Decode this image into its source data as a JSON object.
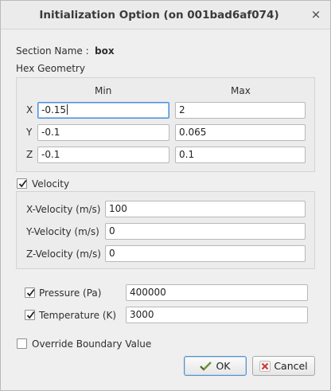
{
  "window": {
    "title": "Initialization Option (on 001bad6af074)",
    "close_glyph": "×"
  },
  "section": {
    "label": "Section Name :",
    "value": "box"
  },
  "hex": {
    "title": "Hex Geometry",
    "min_header": "Min",
    "max_header": "Max",
    "rows": [
      {
        "axis": "X",
        "min": "-0.15",
        "max": "2"
      },
      {
        "axis": "Y",
        "min": "-0.1",
        "max": "0.065"
      },
      {
        "axis": "Z",
        "min": "-0.1",
        "max": "0.1"
      }
    ]
  },
  "velocity": {
    "label": "Velocity",
    "checked": true,
    "fields": [
      {
        "label": "X-Velocity (m/s)",
        "value": "100"
      },
      {
        "label": "Y-Velocity (m/s)",
        "value": "0"
      },
      {
        "label": "Z-Velocity (m/s)",
        "value": "0"
      }
    ]
  },
  "pressure": {
    "label": "Pressure (Pa)",
    "value": "400000",
    "checked": true
  },
  "temperature": {
    "label": "Temperature (K)",
    "value": "3000",
    "checked": true
  },
  "override": {
    "label": "Override Boundary Value",
    "checked": false
  },
  "buttons": {
    "ok": "OK",
    "cancel": "Cancel"
  },
  "colors": {
    "accent": "#4a90d9",
    "cancel_icon": "#d23b3b",
    "ok_icon": "#6b8e3b"
  }
}
